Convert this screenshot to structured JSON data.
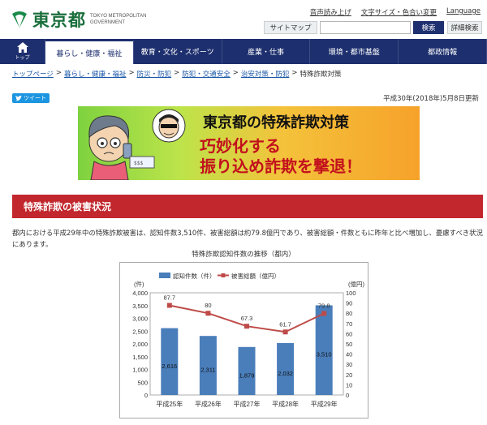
{
  "header": {
    "logo_text": "東京都",
    "logo_en_line1": "TOKYO METROPOLITAN",
    "logo_en_line2": "GOVERNMENT",
    "util_links": [
      "音声読み上げ",
      "文字サイズ・色合い変更",
      "Language"
    ],
    "sitemap_label": "サイトマップ",
    "search_value": "",
    "search_label": "検索",
    "advanced_search_label": "詳細検索"
  },
  "nav": {
    "home_label": "トップ",
    "items": [
      "暮らし・健康・福祉",
      "教育・文化・スポーツ",
      "産業・仕事",
      "環境・都市基盤",
      "都政情報"
    ]
  },
  "breadcrumb": [
    "トップページ",
    "暮らし・健康・福祉",
    "防災・防犯",
    "防犯・交通安全",
    "治安対策・防犯",
    "特殊詐欺対策"
  ],
  "tweet_label": "ツイート",
  "updated": "平成30年(2018年)5月8日更新",
  "banner": {
    "title": "東京都の特殊詐欺対策",
    "line1": "巧妙化する",
    "line2": "振り込め詐欺を撃退！"
  },
  "section_heading": "特殊詐欺の被害状況",
  "body_text": "都内における平成29年中の特殊詐欺被害は、認知件数3,510件、被害総額は約79.8億円であり、被害総額・件数ともに昨年と比べ増加し、憂慮すべき状況にあります。",
  "chart_title": "特殊詐欺認知件数の推移（都内）",
  "colors": {
    "nav": "#1d2f6e",
    "section": "#c1272d",
    "bar": "#4a7ebb",
    "line": "#be4b48"
  },
  "chart_data": {
    "type": "bar",
    "categories": [
      "平成25年",
      "平成26年",
      "平成27年",
      "平成28年",
      "平成29年"
    ],
    "series": [
      {
        "name": "認知件数（件）",
        "type": "bar",
        "axis": "left",
        "values": [
          2616,
          2311,
          1879,
          2032,
          3510
        ],
        "labels": [
          "2,616",
          "2,311",
          "1,879",
          "2,032",
          "3,510"
        ]
      },
      {
        "name": "被害総額（億円）",
        "type": "line",
        "axis": "right",
        "values": [
          87.7,
          80,
          67.3,
          61.7,
          79.8
        ],
        "labels": [
          "87.7",
          "80",
          "67.3",
          "61.7",
          "79.8"
        ]
      }
    ],
    "y_left": {
      "unit": "(件)",
      "ylim": [
        0,
        4000
      ],
      "ticks": [
        "0",
        "500",
        "1,000",
        "1,500",
        "2,000",
        "2,500",
        "3,000",
        "3,500",
        "4,000"
      ]
    },
    "y_right": {
      "unit": "(億円)",
      "ylim": [
        0,
        100
      ],
      "ticks": [
        "0",
        "10",
        "20",
        "30",
        "40",
        "50",
        "60",
        "70",
        "80",
        "90",
        "100"
      ]
    },
    "legend_position": "top"
  }
}
